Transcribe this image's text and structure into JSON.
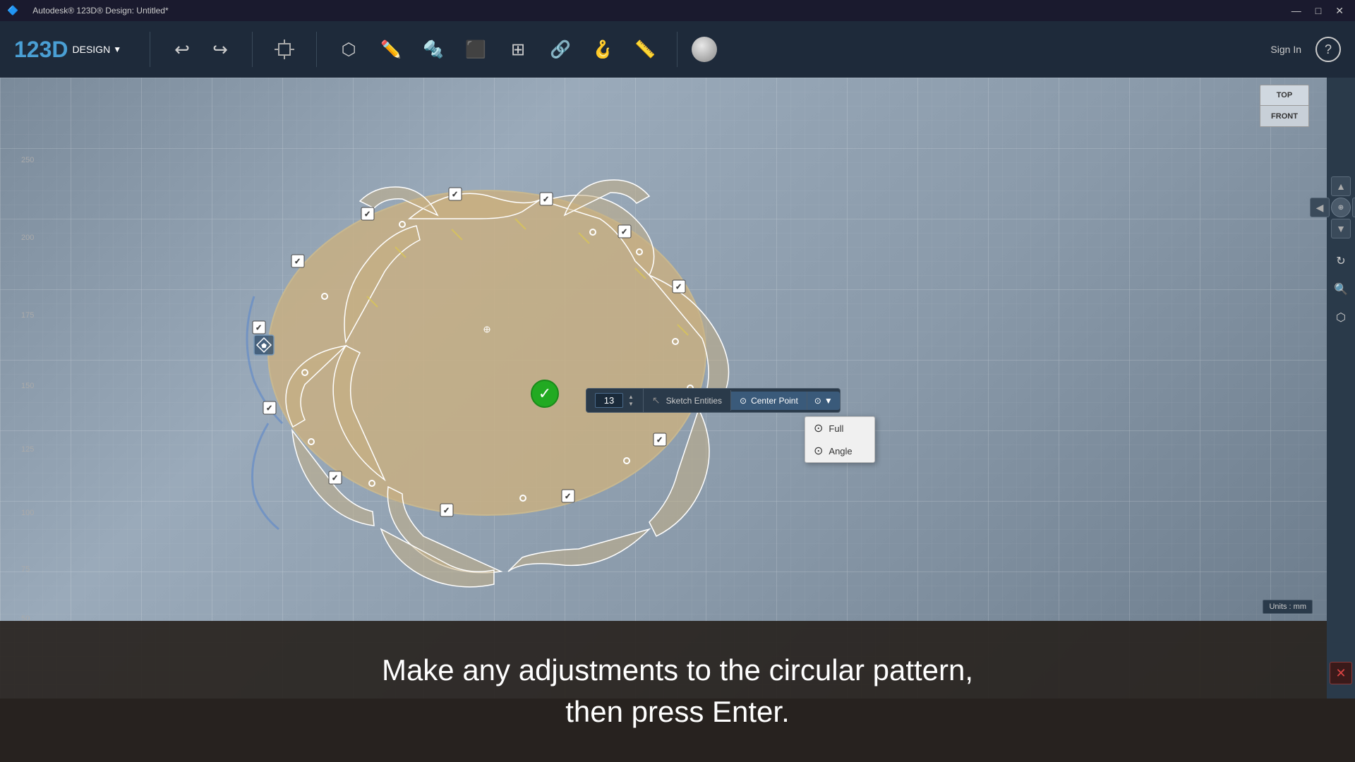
{
  "app": {
    "title": "Autodesk® 123D® Design: Untitled*",
    "logo_123d": "123D",
    "logo_design": "DESIGN",
    "logo_dropdown": "▼"
  },
  "titlebar": {
    "title": "Autodesk® 123D® Design: Untitled*",
    "minimize": "—",
    "maximize": "□",
    "close": "✕"
  },
  "toolbar": {
    "undo": "↩",
    "redo": "↪",
    "signin": "Sign In"
  },
  "view_cube": {
    "top": "TOP",
    "front": "FRONT"
  },
  "sketch_toolbar": {
    "count_value": "13",
    "sketch_entities_label": "Sketch Entities",
    "center_point_label": "Center Point",
    "full_label": "Full",
    "angle_label": "Angle"
  },
  "instruction": {
    "line1": "Make any adjustments to the circular pattern,",
    "line2": "then press Enter."
  },
  "units": {
    "label": "Units : mm"
  },
  "nav": {
    "up": "▲",
    "down": "▼",
    "left": "◀",
    "right": "▶"
  }
}
